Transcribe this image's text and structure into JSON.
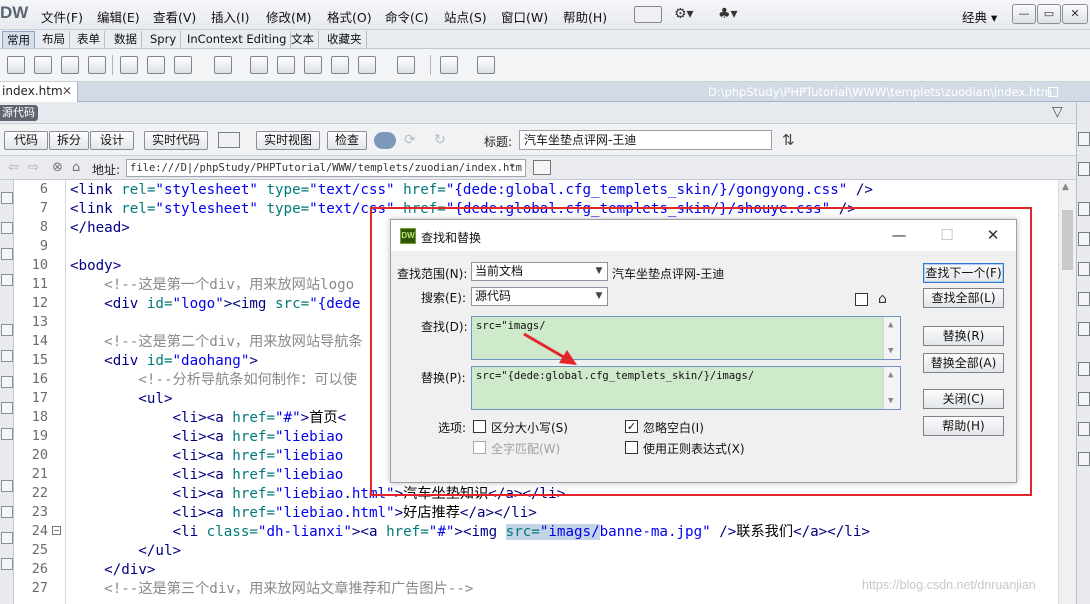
{
  "app": {
    "logo": "DW",
    "menus": [
      "文件(F)",
      "编辑(E)",
      "查看(V)",
      "插入(I)",
      "修改(M)",
      "格式(O)",
      "命令(C)",
      "站点(S)",
      "窗口(W)",
      "帮助(H)"
    ],
    "workspace": "经典 ▾",
    "window_controls": [
      "—",
      "▭",
      "✕"
    ]
  },
  "insert_bar": {
    "tabs": [
      "常用",
      "布局",
      "表单",
      "数据",
      "Spry",
      "InContext Editing",
      "文本",
      "收藏夹"
    ],
    "active": "常用"
  },
  "document": {
    "tab": "index.htm",
    "close": "✕",
    "path": "D:\\phpStudy\\PHPTutorial\\WWW\\templets\\zuodian\\index.htm",
    "source_label": "源代码"
  },
  "doc_toolbar": {
    "views": [
      "代码",
      "拆分",
      "设计"
    ],
    "live_code": "实时代码",
    "live_view": "实时视图",
    "check": "检查",
    "title_label": "标题:",
    "title_value": "汽车坐垫点评网-王迪"
  },
  "address": {
    "label": "地址:",
    "value": "file:///D|/phpStudy/PHPTutorial/WWW/templets/zuodian/index.htm"
  },
  "line_numbers": [
    "6",
    "7",
    "8",
    "9",
    "10",
    "11",
    "12",
    "13",
    "14",
    "15",
    "16",
    "17",
    "18",
    "19",
    "20",
    "21",
    "22",
    "23",
    "24",
    "25",
    "26",
    "27"
  ],
  "code_lines": [
    [
      {
        "c": "tg",
        "t": "<link "
      },
      {
        "c": "at",
        "t": "rel="
      },
      {
        "c": "st",
        "t": "\"stylesheet\""
      },
      {
        "c": "at",
        "t": " type="
      },
      {
        "c": "st",
        "t": "\"text/css\""
      },
      {
        "c": "at",
        "t": " href="
      },
      {
        "c": "st",
        "t": "\"{dede:global.cfg_templets_skin/}/gongyong.css\""
      },
      {
        "c": "tg",
        "t": " />"
      }
    ],
    [
      {
        "c": "tg",
        "t": "<link "
      },
      {
        "c": "at",
        "t": "rel="
      },
      {
        "c": "st",
        "t": "\"stylesheet\""
      },
      {
        "c": "at",
        "t": " type="
      },
      {
        "c": "st",
        "t": "\"text/css\""
      },
      {
        "c": "at",
        "t": " href="
      },
      {
        "c": "st",
        "t": "\"{dede:global.cfg_templets_skin/}/shouye.css\""
      },
      {
        "c": "tg",
        "t": " />"
      }
    ],
    [
      {
        "c": "tg",
        "t": "</head>"
      }
    ],
    [],
    [
      {
        "c": "tg",
        "t": "<body>"
      }
    ],
    [
      {
        "c": "tx",
        "t": "    "
      },
      {
        "c": "cm",
        "t": "<!--这是第一个div，用来放网站logo"
      }
    ],
    [
      {
        "c": "tx",
        "t": "    "
      },
      {
        "c": "tg",
        "t": "<div "
      },
      {
        "c": "at",
        "t": "id="
      },
      {
        "c": "st",
        "t": "\"logo\""
      },
      {
        "c": "tg",
        "t": "><img "
      },
      {
        "c": "at",
        "t": "src="
      },
      {
        "c": "st",
        "t": "\"{dede"
      }
    ],
    [],
    [
      {
        "c": "tx",
        "t": "    "
      },
      {
        "c": "cm",
        "t": "<!--这是第二个div，用来放网站导航条"
      }
    ],
    [
      {
        "c": "tx",
        "t": "    "
      },
      {
        "c": "tg",
        "t": "<div "
      },
      {
        "c": "at",
        "t": "id="
      },
      {
        "c": "st",
        "t": "\"daohang\""
      },
      {
        "c": "tg",
        "t": ">"
      }
    ],
    [
      {
        "c": "tx",
        "t": "        "
      },
      {
        "c": "cm",
        "t": "<!--分析导航条如何制作：可以使"
      }
    ],
    [
      {
        "c": "tx",
        "t": "        "
      },
      {
        "c": "tg",
        "t": "<ul>"
      }
    ],
    [
      {
        "c": "tx",
        "t": "            "
      },
      {
        "c": "tg",
        "t": "<li><a "
      },
      {
        "c": "at",
        "t": "href="
      },
      {
        "c": "st",
        "t": "\"#\""
      },
      {
        "c": "tg",
        "t": ">"
      },
      {
        "c": "tx",
        "t": "首页"
      },
      {
        "c": "tg",
        "t": "<"
      }
    ],
    [
      {
        "c": "tx",
        "t": "            "
      },
      {
        "c": "tg",
        "t": "<li><a "
      },
      {
        "c": "at",
        "t": "href="
      },
      {
        "c": "st",
        "t": "\"liebiao"
      }
    ],
    [
      {
        "c": "tx",
        "t": "            "
      },
      {
        "c": "tg",
        "t": "<li><a "
      },
      {
        "c": "at",
        "t": "href="
      },
      {
        "c": "st",
        "t": "\"liebiao"
      }
    ],
    [
      {
        "c": "tx",
        "t": "            "
      },
      {
        "c": "tg",
        "t": "<li><a "
      },
      {
        "c": "at",
        "t": "href="
      },
      {
        "c": "st",
        "t": "\"liebiao"
      }
    ],
    [
      {
        "c": "tx",
        "t": "            "
      },
      {
        "c": "tg",
        "t": "<li><a "
      },
      {
        "c": "at",
        "t": "href="
      },
      {
        "c": "st",
        "t": "\"liebiao.html\""
      },
      {
        "c": "tg",
        "t": ">"
      },
      {
        "c": "tx",
        "t": "汽车坐垫知识"
      },
      {
        "c": "tg",
        "t": "</a></li>"
      }
    ],
    [
      {
        "c": "tx",
        "t": "            "
      },
      {
        "c": "tg",
        "t": "<li><a "
      },
      {
        "c": "at",
        "t": "href="
      },
      {
        "c": "st",
        "t": "\"liebiao.html\""
      },
      {
        "c": "tg",
        "t": ">"
      },
      {
        "c": "tx",
        "t": "好店推荐"
      },
      {
        "c": "tg",
        "t": "</a></li>"
      }
    ],
    [
      {
        "c": "tx",
        "t": "            "
      },
      {
        "c": "tg",
        "t": "<li "
      },
      {
        "c": "at",
        "t": "class="
      },
      {
        "c": "st",
        "t": "\"dh-lianxi\""
      },
      {
        "c": "tg",
        "t": "><a "
      },
      {
        "c": "at",
        "t": "href="
      },
      {
        "c": "st",
        "t": "\"#\""
      },
      {
        "c": "tg",
        "t": "><img "
      },
      {
        "c": "at",
        "t": "src=",
        "hl": true
      },
      {
        "c": "st",
        "t": "\"imags/",
        "hl": true
      },
      {
        "c": "st",
        "t": "banne-ma.jpg\""
      },
      {
        "c": "tg",
        "t": " />"
      },
      {
        "c": "tx",
        "t": "联系我们"
      },
      {
        "c": "tg",
        "t": "</a></li>"
      }
    ],
    [
      {
        "c": "tx",
        "t": "        "
      },
      {
        "c": "tg",
        "t": "</ul>"
      }
    ],
    [
      {
        "c": "tx",
        "t": "    "
      },
      {
        "c": "tg",
        "t": "</div>"
      }
    ],
    [
      {
        "c": "tx",
        "t": "    "
      },
      {
        "c": "cm",
        "t": "<!--这是第三个div，用来放网站文章推荐和广告图片-->"
      }
    ]
  ],
  "dialog": {
    "title": "查找和替换",
    "scope_label": "查找范围(N):",
    "scope_value": "当前文档",
    "scope_doc": "汽车坐垫点评网-王迪",
    "search_label": "搜索(E):",
    "search_value": "源代码",
    "find_label": "查找(D):",
    "find_value": "src=\"imags/",
    "replace_label": "替换(P):",
    "replace_value": "src=\"{dede:global.cfg_templets_skin/}/imags/",
    "options_label": "选项:",
    "options": [
      {
        "label": "区分大小写(S)",
        "checked": false,
        "enabled": true
      },
      {
        "label": "忽略空白(I)",
        "checked": true,
        "enabled": true
      },
      {
        "label": "全字匹配(W)",
        "checked": false,
        "enabled": false
      },
      {
        "label": "使用正则表达式(X)",
        "checked": false,
        "enabled": true
      }
    ],
    "buttons": {
      "find_next": "查找下一个(F)",
      "find_all": "查找全部(L)",
      "replace": "替换(R)",
      "replace_all": "替换全部(A)",
      "close": "关闭(C)",
      "help": "帮助(H)"
    },
    "title_controls": [
      "—",
      "☐",
      "✕"
    ]
  },
  "watermark": "https://blog.csdn.net/dnruanjian",
  "colors": {
    "highlight_box": "#e2262b",
    "arrow": "#e2262b",
    "textarea_bg": "#cfeacb"
  }
}
